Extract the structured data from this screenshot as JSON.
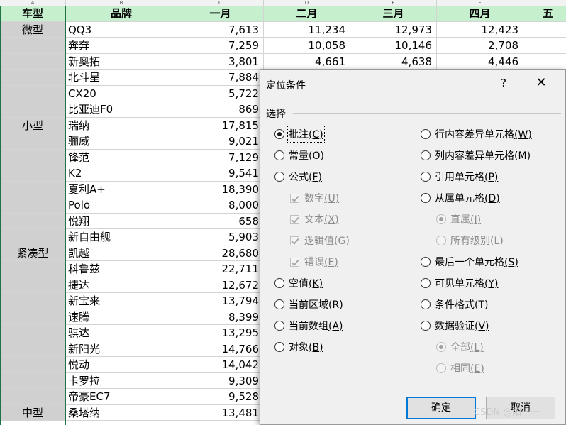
{
  "columns": [
    "A",
    "B",
    "C",
    "D",
    "E",
    "F"
  ],
  "header": [
    "车型",
    "品牌",
    "一月",
    "二月",
    "三月",
    "四月",
    "五"
  ],
  "rows": [
    [
      "微型",
      "QQ3",
      "7,613",
      "11,234",
      "12,973",
      "12,423"
    ],
    [
      "",
      "奔奔",
      "7,259",
      "10,058",
      "10,146",
      "2,708"
    ],
    [
      "",
      "新奥拓",
      "3,801",
      "4,661",
      "4,638",
      "4,446"
    ],
    [
      "",
      "北斗星",
      "7,884",
      "",
      "",
      ""
    ],
    [
      "",
      "CX20",
      "5,722",
      "",
      "",
      ""
    ],
    [
      "",
      "比亚迪F0",
      "869",
      "",
      "",
      ""
    ],
    [
      "小型",
      "瑞纳",
      "17,815",
      "",
      "",
      ""
    ],
    [
      "",
      "骊威",
      "9,021",
      "",
      "",
      ""
    ],
    [
      "",
      "锋范",
      "7,129",
      "",
      "",
      ""
    ],
    [
      "",
      "K2",
      "9,541",
      "",
      "",
      ""
    ],
    [
      "",
      "夏利A+",
      "18,390",
      "",
      "",
      ""
    ],
    [
      "",
      "Polo",
      "8,000",
      "",
      "",
      ""
    ],
    [
      "",
      "悦翔",
      "658",
      "",
      "",
      ""
    ],
    [
      "",
      "新自由舰",
      "5,903",
      "",
      "",
      ""
    ],
    [
      "紧凑型",
      "凯越",
      "28,680",
      "",
      "",
      ""
    ],
    [
      "",
      "科鲁兹",
      "22,711",
      "",
      "",
      ""
    ],
    [
      "",
      "捷达",
      "12,672",
      "",
      "",
      ""
    ],
    [
      "",
      "新宝来",
      "13,794",
      "",
      "",
      ""
    ],
    [
      "",
      "速腾",
      "8,399",
      "",
      "",
      ""
    ],
    [
      "",
      "骐达",
      "13,295",
      "",
      "",
      ""
    ],
    [
      "",
      "新阳光",
      "14,766",
      "",
      "",
      ""
    ],
    [
      "",
      "悦动",
      "14,042",
      "",
      "",
      ""
    ],
    [
      "",
      "卡罗拉",
      "9,309",
      "",
      "",
      ""
    ],
    [
      "",
      "帝豪EC7",
      "9,528",
      "",
      "",
      ""
    ],
    [
      "中型",
      "桑塔纳",
      "13,481",
      "",
      "",
      ""
    ]
  ],
  "dialog": {
    "title": "定位条件",
    "help": "?",
    "close": "✕",
    "group_label": "选择",
    "left_options": [
      {
        "label": "批注",
        "key": "C",
        "type": "radio",
        "checked": true,
        "disabled": false
      },
      {
        "label": "常量",
        "key": "O",
        "type": "radio",
        "checked": false,
        "disabled": false
      },
      {
        "label": "公式",
        "key": "F",
        "type": "radio",
        "checked": false,
        "disabled": false
      },
      {
        "label": "数字",
        "key": "U",
        "type": "check",
        "checked": true,
        "disabled": true
      },
      {
        "label": "文本",
        "key": "X",
        "type": "check",
        "checked": true,
        "disabled": true
      },
      {
        "label": "逻辑值",
        "key": "G",
        "type": "check",
        "checked": true,
        "disabled": true
      },
      {
        "label": "错误",
        "key": "E",
        "type": "check",
        "checked": true,
        "disabled": true
      },
      {
        "label": "空值",
        "key": "K",
        "type": "radio",
        "checked": false,
        "disabled": false
      },
      {
        "label": "当前区域",
        "key": "R",
        "type": "radio",
        "checked": false,
        "disabled": false
      },
      {
        "label": "当前数组",
        "key": "A",
        "type": "radio",
        "checked": false,
        "disabled": false
      },
      {
        "label": "对象",
        "key": "B",
        "type": "radio",
        "checked": false,
        "disabled": false
      }
    ],
    "right_options": [
      {
        "label": "行内容差异单元格",
        "key": "W",
        "type": "radio",
        "checked": false,
        "disabled": false
      },
      {
        "label": "列内容差异单元格",
        "key": "M",
        "type": "radio",
        "checked": false,
        "disabled": false
      },
      {
        "label": "引用单元格",
        "key": "P",
        "type": "radio",
        "checked": false,
        "disabled": false
      },
      {
        "label": "从属单元格",
        "key": "D",
        "type": "radio",
        "checked": false,
        "disabled": false
      },
      {
        "label": "直属",
        "key": "I",
        "type": "radio",
        "checked": true,
        "disabled": true
      },
      {
        "label": "所有级别",
        "key": "L",
        "type": "radio",
        "checked": false,
        "disabled": true
      },
      {
        "label": "最后一个单元格",
        "key": "S",
        "type": "radio",
        "checked": false,
        "disabled": false
      },
      {
        "label": "可见单元格",
        "key": "Y",
        "type": "radio",
        "checked": false,
        "disabled": false
      },
      {
        "label": "条件格式",
        "key": "T",
        "type": "radio",
        "checked": false,
        "disabled": false
      },
      {
        "label": "数据验证",
        "key": "V",
        "type": "radio",
        "checked": false,
        "disabled": false
      },
      {
        "label": "全部",
        "key": "L",
        "type": "radio",
        "checked": true,
        "disabled": true
      },
      {
        "label": "相同",
        "key": "E",
        "type": "radio",
        "checked": false,
        "disabled": true
      }
    ],
    "ok_label": "确定",
    "cancel_label": "取消"
  },
  "watermark": "CSDN @阳一一"
}
